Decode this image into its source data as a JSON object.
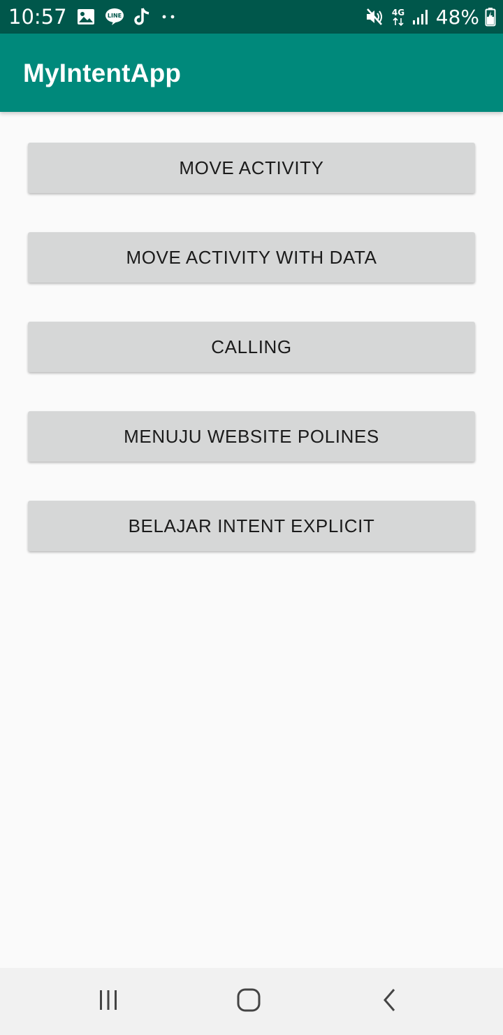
{
  "status_bar": {
    "time": "10:57",
    "battery_percent": "48%",
    "network_label": "4G",
    "icons": [
      "gallery-icon",
      "line-app-icon",
      "tiktok-icon",
      "more-notifications-icon",
      "mute-icon",
      "network-4g-icon",
      "signal-icon",
      "battery-icon"
    ]
  },
  "app_bar": {
    "title": "MyIntentApp"
  },
  "buttons": [
    {
      "label": "MOVE ACTIVITY"
    },
    {
      "label": "MOVE ACTIVITY WITH DATA"
    },
    {
      "label": "CALLING"
    },
    {
      "label": "MENUJU WEBSITE POLINES"
    },
    {
      "label": "BELAJAR INTENT EXPLICIT"
    }
  ],
  "nav_bar": {
    "items": [
      "recent-apps-icon",
      "home-icon",
      "back-icon"
    ]
  },
  "colors": {
    "status_bar": "#00574b",
    "app_bar": "#00897b",
    "background": "#fafafa",
    "button": "#d6d7d7",
    "nav_bar": "#f1f1f1"
  }
}
